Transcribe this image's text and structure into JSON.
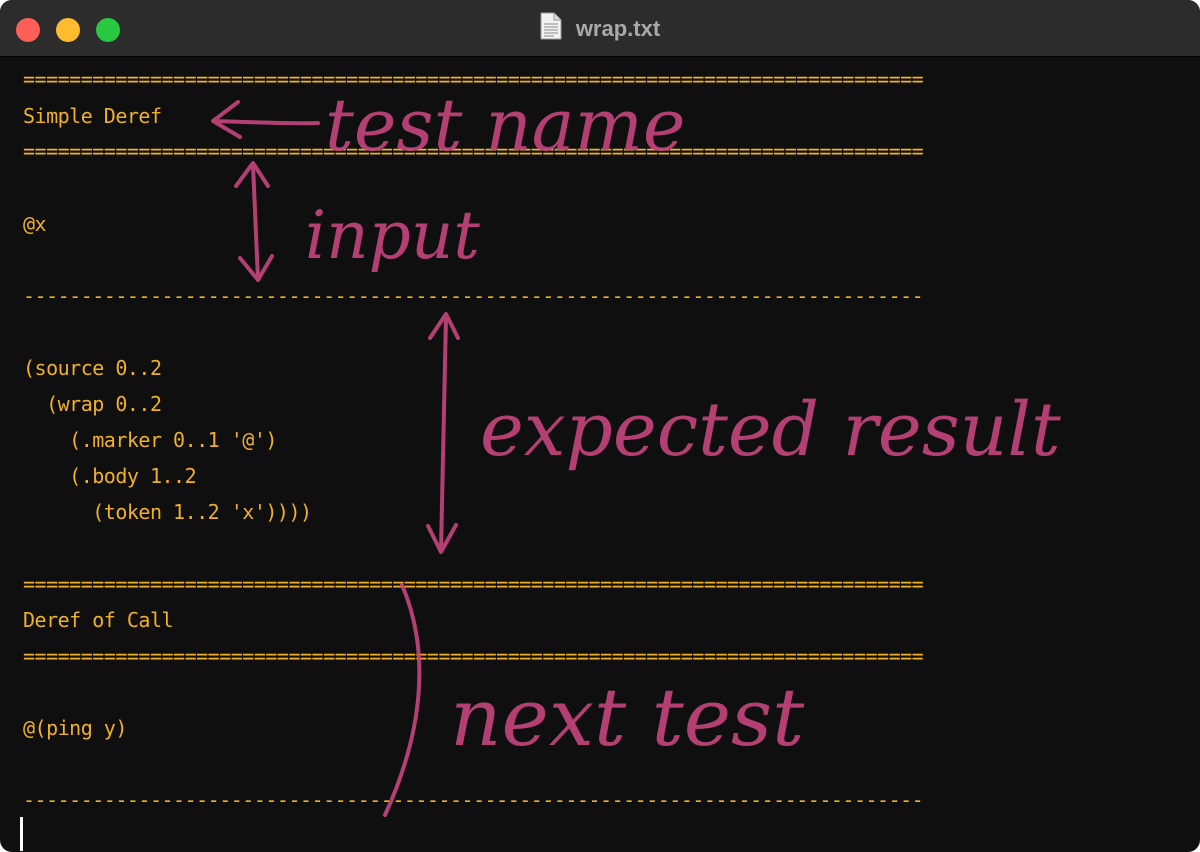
{
  "window": {
    "title": "wrap.txt"
  },
  "editor": {
    "lines": [
      "==============================================================================",
      "Simple Deref",
      "==============================================================================",
      "@x",
      "------------------------------------------------------------------------------",
      "(source 0..2",
      "  (wrap 0..2",
      "    (.marker 0..1 '@')",
      "    (.body 1..2",
      "      (token 1..2 'x'))))",
      "==============================================================================",
      "Deref of Call",
      "==============================================================================",
      "@(ping y)",
      "------------------------------------------------------------------------------"
    ]
  },
  "annotations": {
    "test_name": "test name",
    "input": "input",
    "expected_result": "expected result",
    "next_test": "next test"
  },
  "colors": {
    "text": "#f0b028",
    "annotation": "#c5457e",
    "background": "#0f0f0f"
  }
}
